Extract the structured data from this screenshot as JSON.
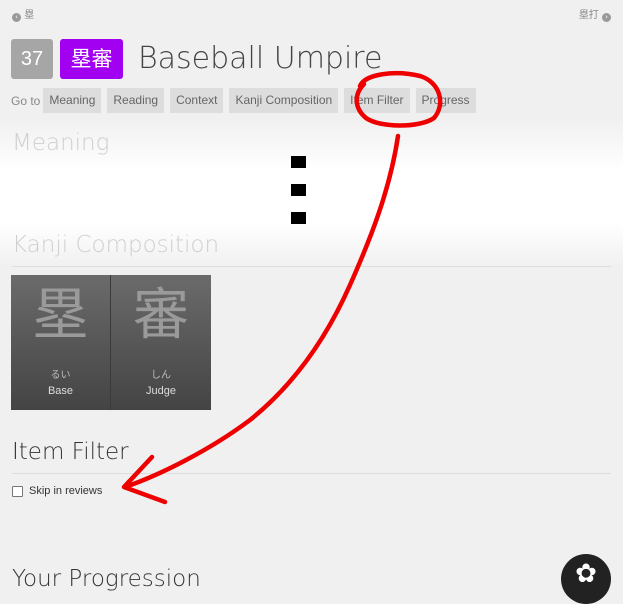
{
  "topnav": {
    "prev_icon": "chevron-left-circle",
    "prev_label": "塁",
    "next_label": "塁打",
    "next_icon": "chevron-right-circle"
  },
  "header": {
    "level": "37",
    "characters": "塁審",
    "meaning": "Baseball Umpire"
  },
  "goto": {
    "label": "Go to",
    "items": [
      "Meaning",
      "Reading",
      "Context",
      "Kanji Composition",
      "Item Filter",
      "Progress"
    ]
  },
  "sections": {
    "meaning": "Meaning",
    "kanji_composition": "Kanji Composition",
    "item_filter": "Item Filter",
    "progression": "Your Progression"
  },
  "kanji": [
    {
      "character": "塁",
      "reading": "るい",
      "meaning": "Base"
    },
    {
      "character": "審",
      "reading": "しん",
      "meaning": "Judge"
    }
  ],
  "filter": {
    "checkbox_label": "Skip in reviews",
    "checked": false
  },
  "colors": {
    "vocab": "#a100f1",
    "level": "#a6a6a6",
    "annotation": "#ee0000"
  }
}
